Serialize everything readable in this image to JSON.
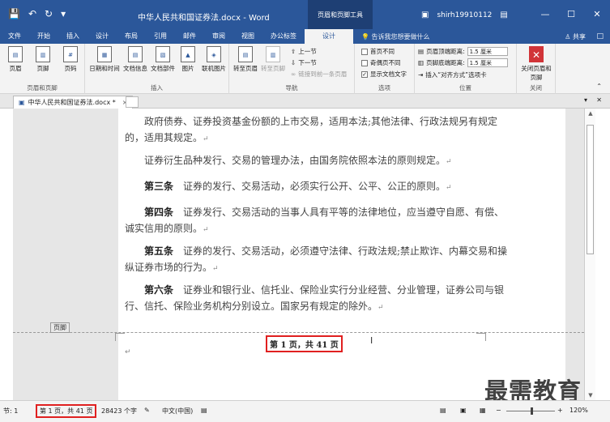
{
  "titlebar": {
    "qat_save": "💾",
    "qat_undo": "↶",
    "qat_redo": "↻",
    "qat_more": "▾",
    "title": "中华人民共和国证券法.docx - Word",
    "context_tab": "页眉和页脚工具",
    "user": "shirh19910112",
    "minimize": "—",
    "restore": "☐",
    "close": "✕"
  },
  "tabs": [
    {
      "label": "文件"
    },
    {
      "label": "开始"
    },
    {
      "label": "插入"
    },
    {
      "label": "设计"
    },
    {
      "label": "布局"
    },
    {
      "label": "引用"
    },
    {
      "label": "邮件"
    },
    {
      "label": "审阅"
    },
    {
      "label": "视图"
    },
    {
      "label": "办公标签"
    },
    {
      "label": "设计"
    }
  ],
  "tell_me": "告诉我您想要做什么",
  "share": "共享",
  "ribbon": {
    "groups": {
      "header_footer": "页眉和页脚",
      "insert": "插入",
      "nav": "导航",
      "options": "选项",
      "position": "位置",
      "close": "关闭"
    },
    "header_btn": "页眉",
    "footer_btn": "页脚",
    "pagenum_btn": "页码",
    "datetime_btn": "日期和时间",
    "docinfo_btn": "文档信息",
    "parts_btn": "文档部件",
    "picture_btn": "图片",
    "online_picture_btn": "联机图片",
    "goto_header": "转至页眉",
    "goto_footer": "转至页脚",
    "prev_section": "上一节",
    "next_section": "下一节",
    "link_previous": "链接到前一条页眉",
    "first_page_diff": "首页不同",
    "odd_even_diff": "奇偶页不同",
    "show_doc_text": "显示文档文字",
    "header_top": "页眉顶端距离:",
    "footer_bottom": "页脚底端距离:",
    "header_top_val": "1.5 厘米",
    "footer_bottom_val": "1.5 厘米",
    "insert_align_tab": "插入“对齐方式”选项卡",
    "close_hf": "关闭页眉和页脚"
  },
  "doctab": {
    "name": "中华人民共和国证券法.docx *",
    "close": "×"
  },
  "document": {
    "paragraphs": [
      {
        "lead": "",
        "text": "　　政府债券、证券投资基金份额的上市交易，适用本法;其他法律、行政法规另有规定的，适用其规定。"
      },
      {
        "lead": "",
        "text": "　　证券衍生品种发行、交易的管理办法，由国务院依照本法的原则规定。"
      },
      {
        "lead": "　　第三条",
        "text": "　证券的发行、交易活动，必须实行公开、公平、公正的原则。"
      },
      {
        "lead": "　　第四条",
        "text": "　证券发行、交易活动的当事人具有平等的法律地位，应当遵守自愿、有偿、诚实信用的原则。"
      },
      {
        "lead": "　　第五条",
        "text": "　证券的发行、交易活动，必须遵守法律、行政法规;禁止欺诈、内幕交易和操纵证券市场的行为。"
      },
      {
        "lead": "　　第六条",
        "text": "　证券业和银行业、信托业、保险业实行分业经营、分业管理，证券公司与银行、信托、保险业务机构分别设立。国家另有规定的除外。"
      }
    ],
    "return_mark": "↵",
    "footer_label": "页脚",
    "page_number_field": "第 1 页，共 41 页"
  },
  "statusbar": {
    "section": "节: 1",
    "page": "第 1 页，共 41 页",
    "words": "28423 个字",
    "language": "中文(中国)",
    "zoom": "120%"
  },
  "watermark": "最需教育"
}
